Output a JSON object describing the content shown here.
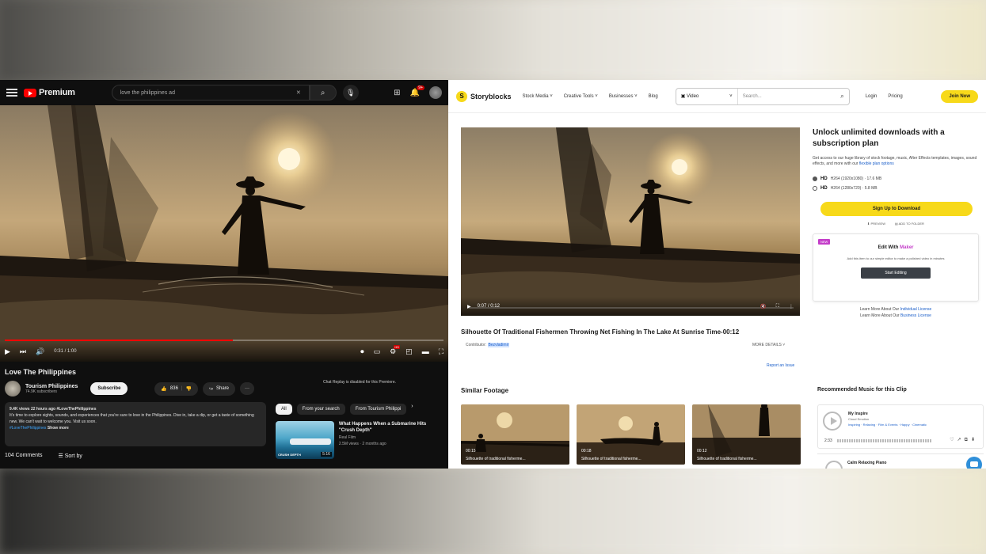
{
  "youtube": {
    "logo": "Premium",
    "search_query": "love the philippines ad",
    "notification_count": "9+",
    "player": {
      "time": "0:31 / 1:00",
      "progress": 0.52
    },
    "video_title": "Love The Philippines",
    "channel": {
      "name": "Tourism Philippines",
      "subscribers": "74.9K subscribers",
      "subscribe_label": "Subscribe"
    },
    "actions": {
      "likes": "836",
      "share": "Share",
      "more": "···"
    },
    "description": {
      "meta": "9.4K views  22 hours ago  #LoveThePhilippines",
      "text": "It's time to explore sights, sounds, and experiences that you're sure to love in the Philippines. Dive in, take a dip, or get a taste of something new. We can't wait to welcome you. Visit us soon.",
      "hashtag": "#LoveThePhilippines",
      "more": "Show more"
    },
    "comments": {
      "count": "104 Comments",
      "sort": "Sort by"
    },
    "sidebar": {
      "chat_disabled": "Chat Replay is disabled for this Premiere.",
      "chips": [
        "All",
        "From your search",
        "From Tourism Philippi"
      ],
      "recommended": {
        "title": "What Happens When a Submarine Hits \"Crush Depth\"",
        "channel": "Real Film",
        "meta": "2.5M views · 2 months ago",
        "duration": "5:16",
        "caption": "CRUSH DEPTH"
      }
    }
  },
  "storyblocks": {
    "brand": "Storyblocks",
    "nav": [
      "Stock Media",
      "Creative Tools",
      "Businesses",
      "Blog"
    ],
    "search": {
      "type": "Video",
      "placeholder": "Search..."
    },
    "login": "Login",
    "pricing": "Pricing",
    "join": "Join Now",
    "player": {
      "time": "0:07 / 0:12",
      "progress": 0.58
    },
    "title": "Silhouette Of Traditional Fishermen Throwing Net Fishing In The Lake At Sunrise Time-00:12",
    "contributor_label": "Contributor:",
    "contributor_name": "Bezvladimir",
    "more_details": "MORE DETAILS",
    "report": "Report an Issue",
    "similar_heading": "Similar Footage",
    "similar": [
      {
        "duration": "00:15",
        "label": "Silhouette of traditional fisherme..."
      },
      {
        "duration": "00:18",
        "label": "Silhouette of traditional fisherme..."
      },
      {
        "duration": "00:12",
        "label": "Silhouette of traditional fisherme..."
      }
    ],
    "panel": {
      "heading": "Unlock unlimited downloads with a subscription plan",
      "desc": "Get access to our huge library of stock footage, music, After Effects templates, images, sound effects, and more with our",
      "desc_link": "flexible plan options",
      "options": [
        {
          "badge": "HD",
          "text": "H264 (1920x1080) · 17.6 MB",
          "selected": true
        },
        {
          "badge": "HD",
          "text": "H264 (1280x720) · 5.8 MB",
          "selected": false
        }
      ],
      "signup": "Sign Up to Download",
      "preview": "PREVIEW",
      "add_folder": "ADD TO FOLDER",
      "maker_badge": "NEW",
      "maker_heading_prefix": "Edit With",
      "maker_heading_brand": "Maker",
      "maker_desc": "Add this item to our simple editor to make a polished video in minutes",
      "maker_button": "Start Editing",
      "license_1_prefix": "Learn More About Our",
      "license_1_link": "Individual License",
      "license_2_prefix": "Learn More About Our",
      "license_2_link": "Business License"
    },
    "music": {
      "heading": "Recommended Music for this Clip",
      "track_1": {
        "title": "My Inspire",
        "artist": "Cloud Emotion",
        "tags": "Inspiring · Relaxing · Film & Events · Happy · Cinematic",
        "time": "2:33"
      },
      "track_2": {
        "title": "Calm Relaxing Piano"
      }
    }
  },
  "colors": {
    "yt_red": "#ff0000",
    "sb_yellow": "#f7d91a",
    "link_blue": "#1a5ec9",
    "maker_purple": "#c43ec9"
  }
}
